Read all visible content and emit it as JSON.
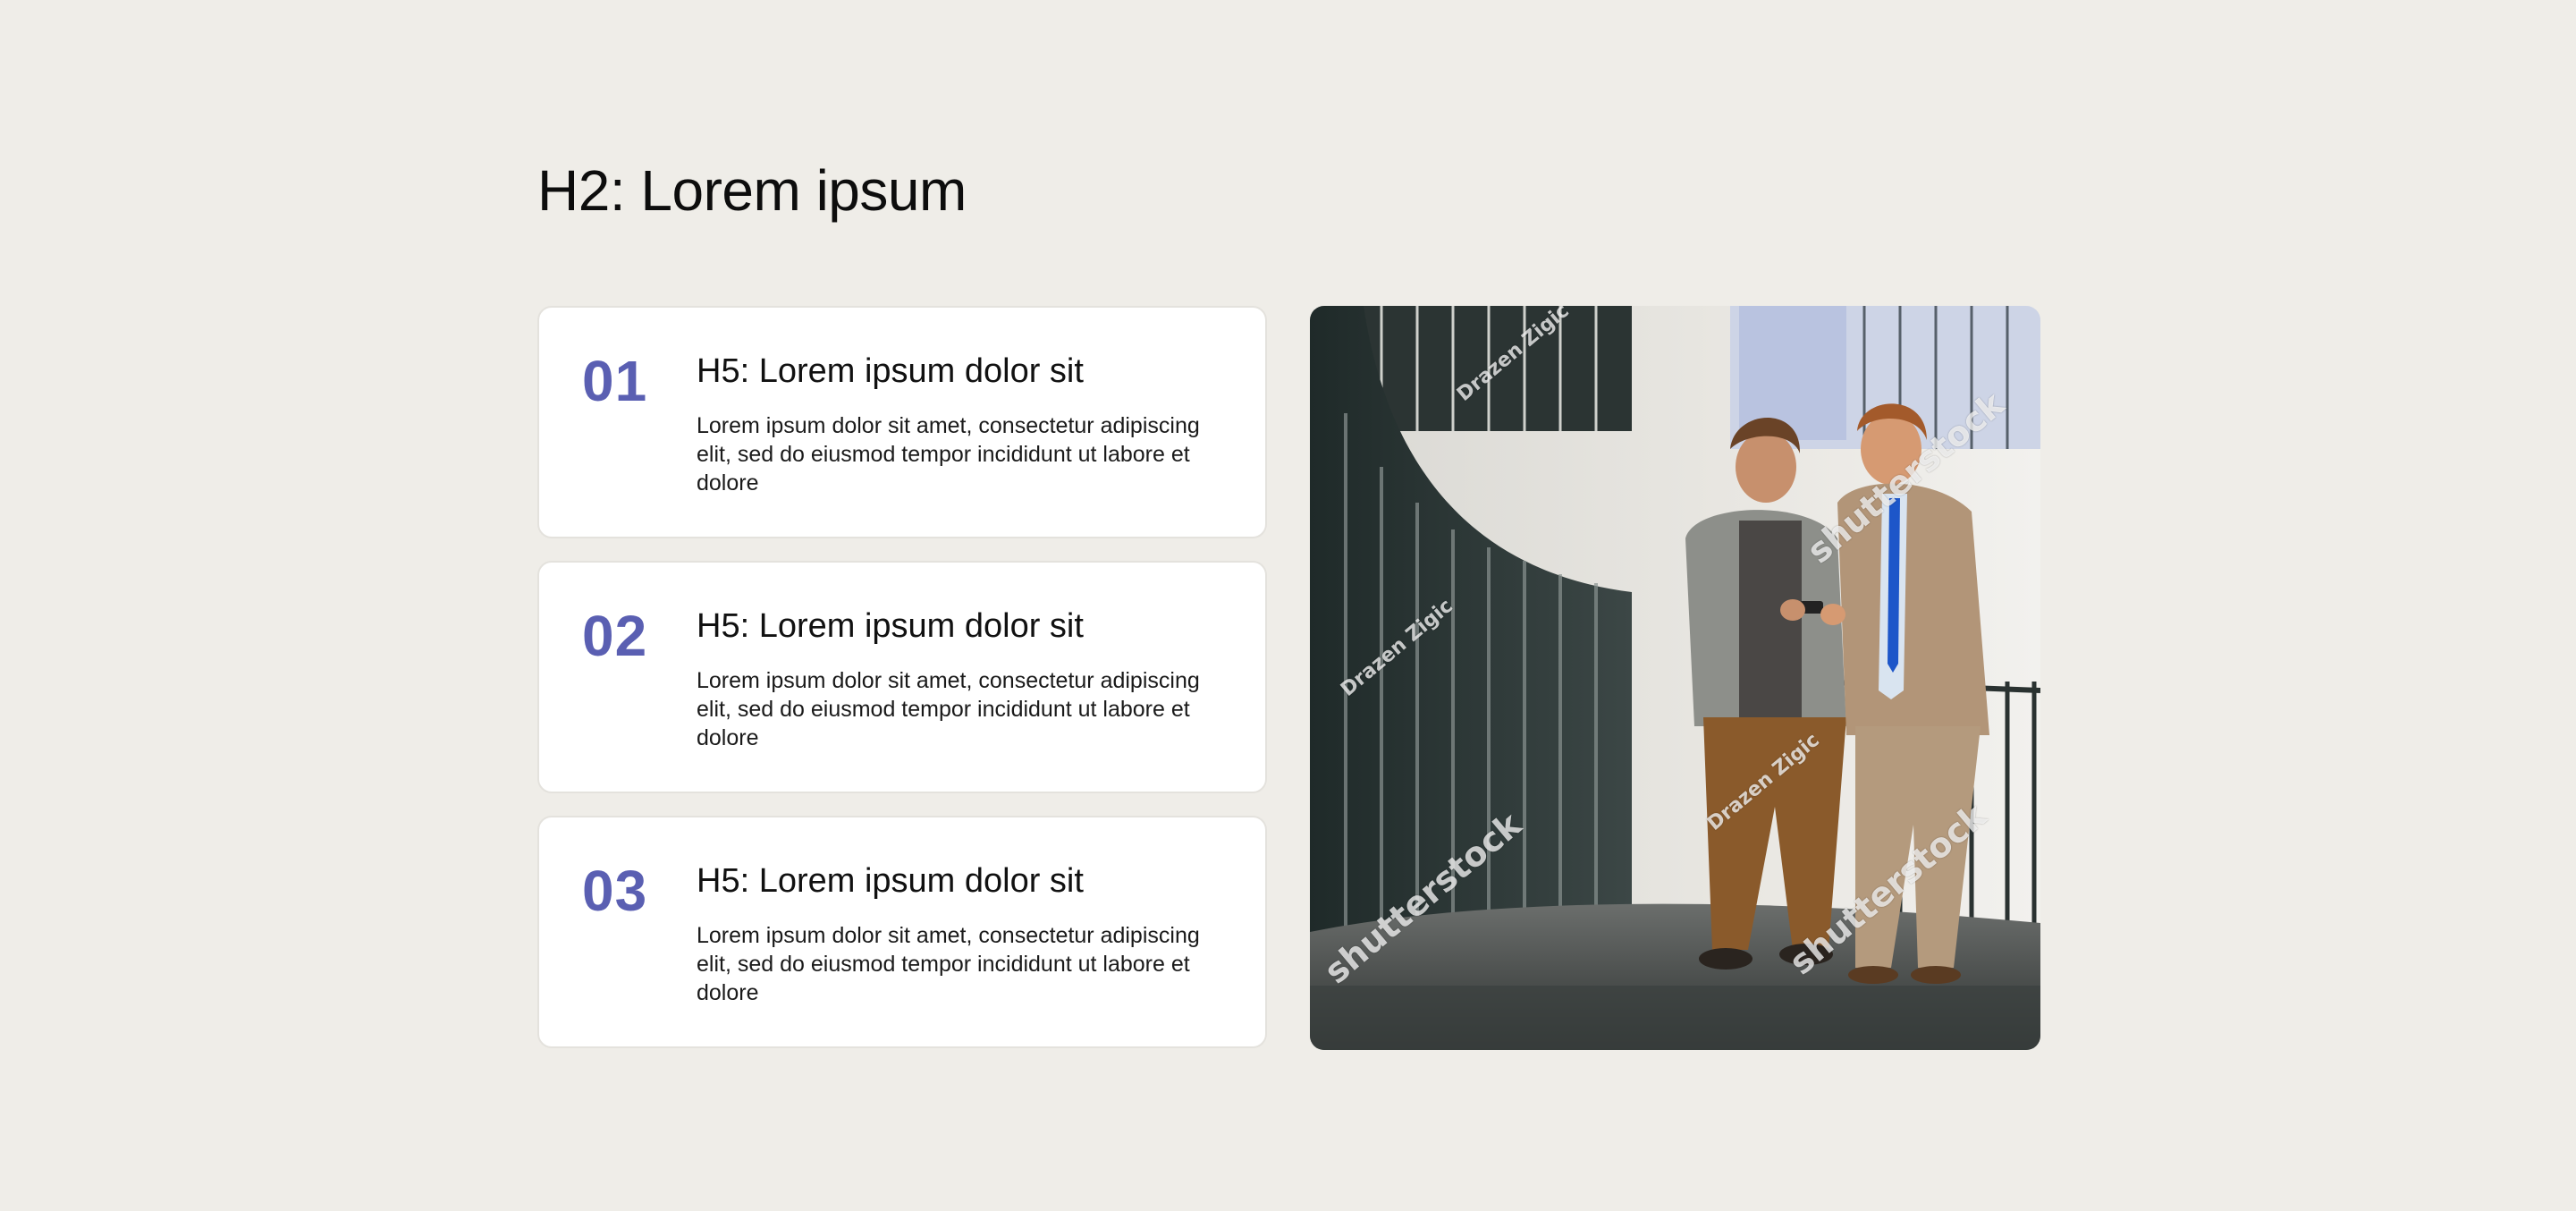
{
  "page": {
    "title": "H2: Lorem ipsum"
  },
  "cards": [
    {
      "number": "01",
      "heading": "H5: Lorem ipsum dolor sit",
      "text": "Lorem ipsum dolor sit amet, consectetur adipiscing elit, sed do eiusmod tempor incididunt ut labore et dolore"
    },
    {
      "number": "02",
      "heading": "H5: Lorem ipsum dolor sit",
      "text": "Lorem ipsum dolor sit amet, consectetur adipiscing elit, sed do eiusmod tempor incididunt ut labore et dolore"
    },
    {
      "number": "03",
      "heading": "H5: Lorem ipsum dolor sit",
      "text": "Lorem ipsum dolor sit amet, consectetur adipiscing elit, sed do eiusmod tempor incididunt ut labore et dolore"
    }
  ],
  "photo": {
    "watermarks": {
      "author": "Drazen Zigic",
      "brand": "shutterstock"
    }
  },
  "colors": {
    "background": "#efede8",
    "accent": "#5a5fb2",
    "card": "#ffffff"
  }
}
